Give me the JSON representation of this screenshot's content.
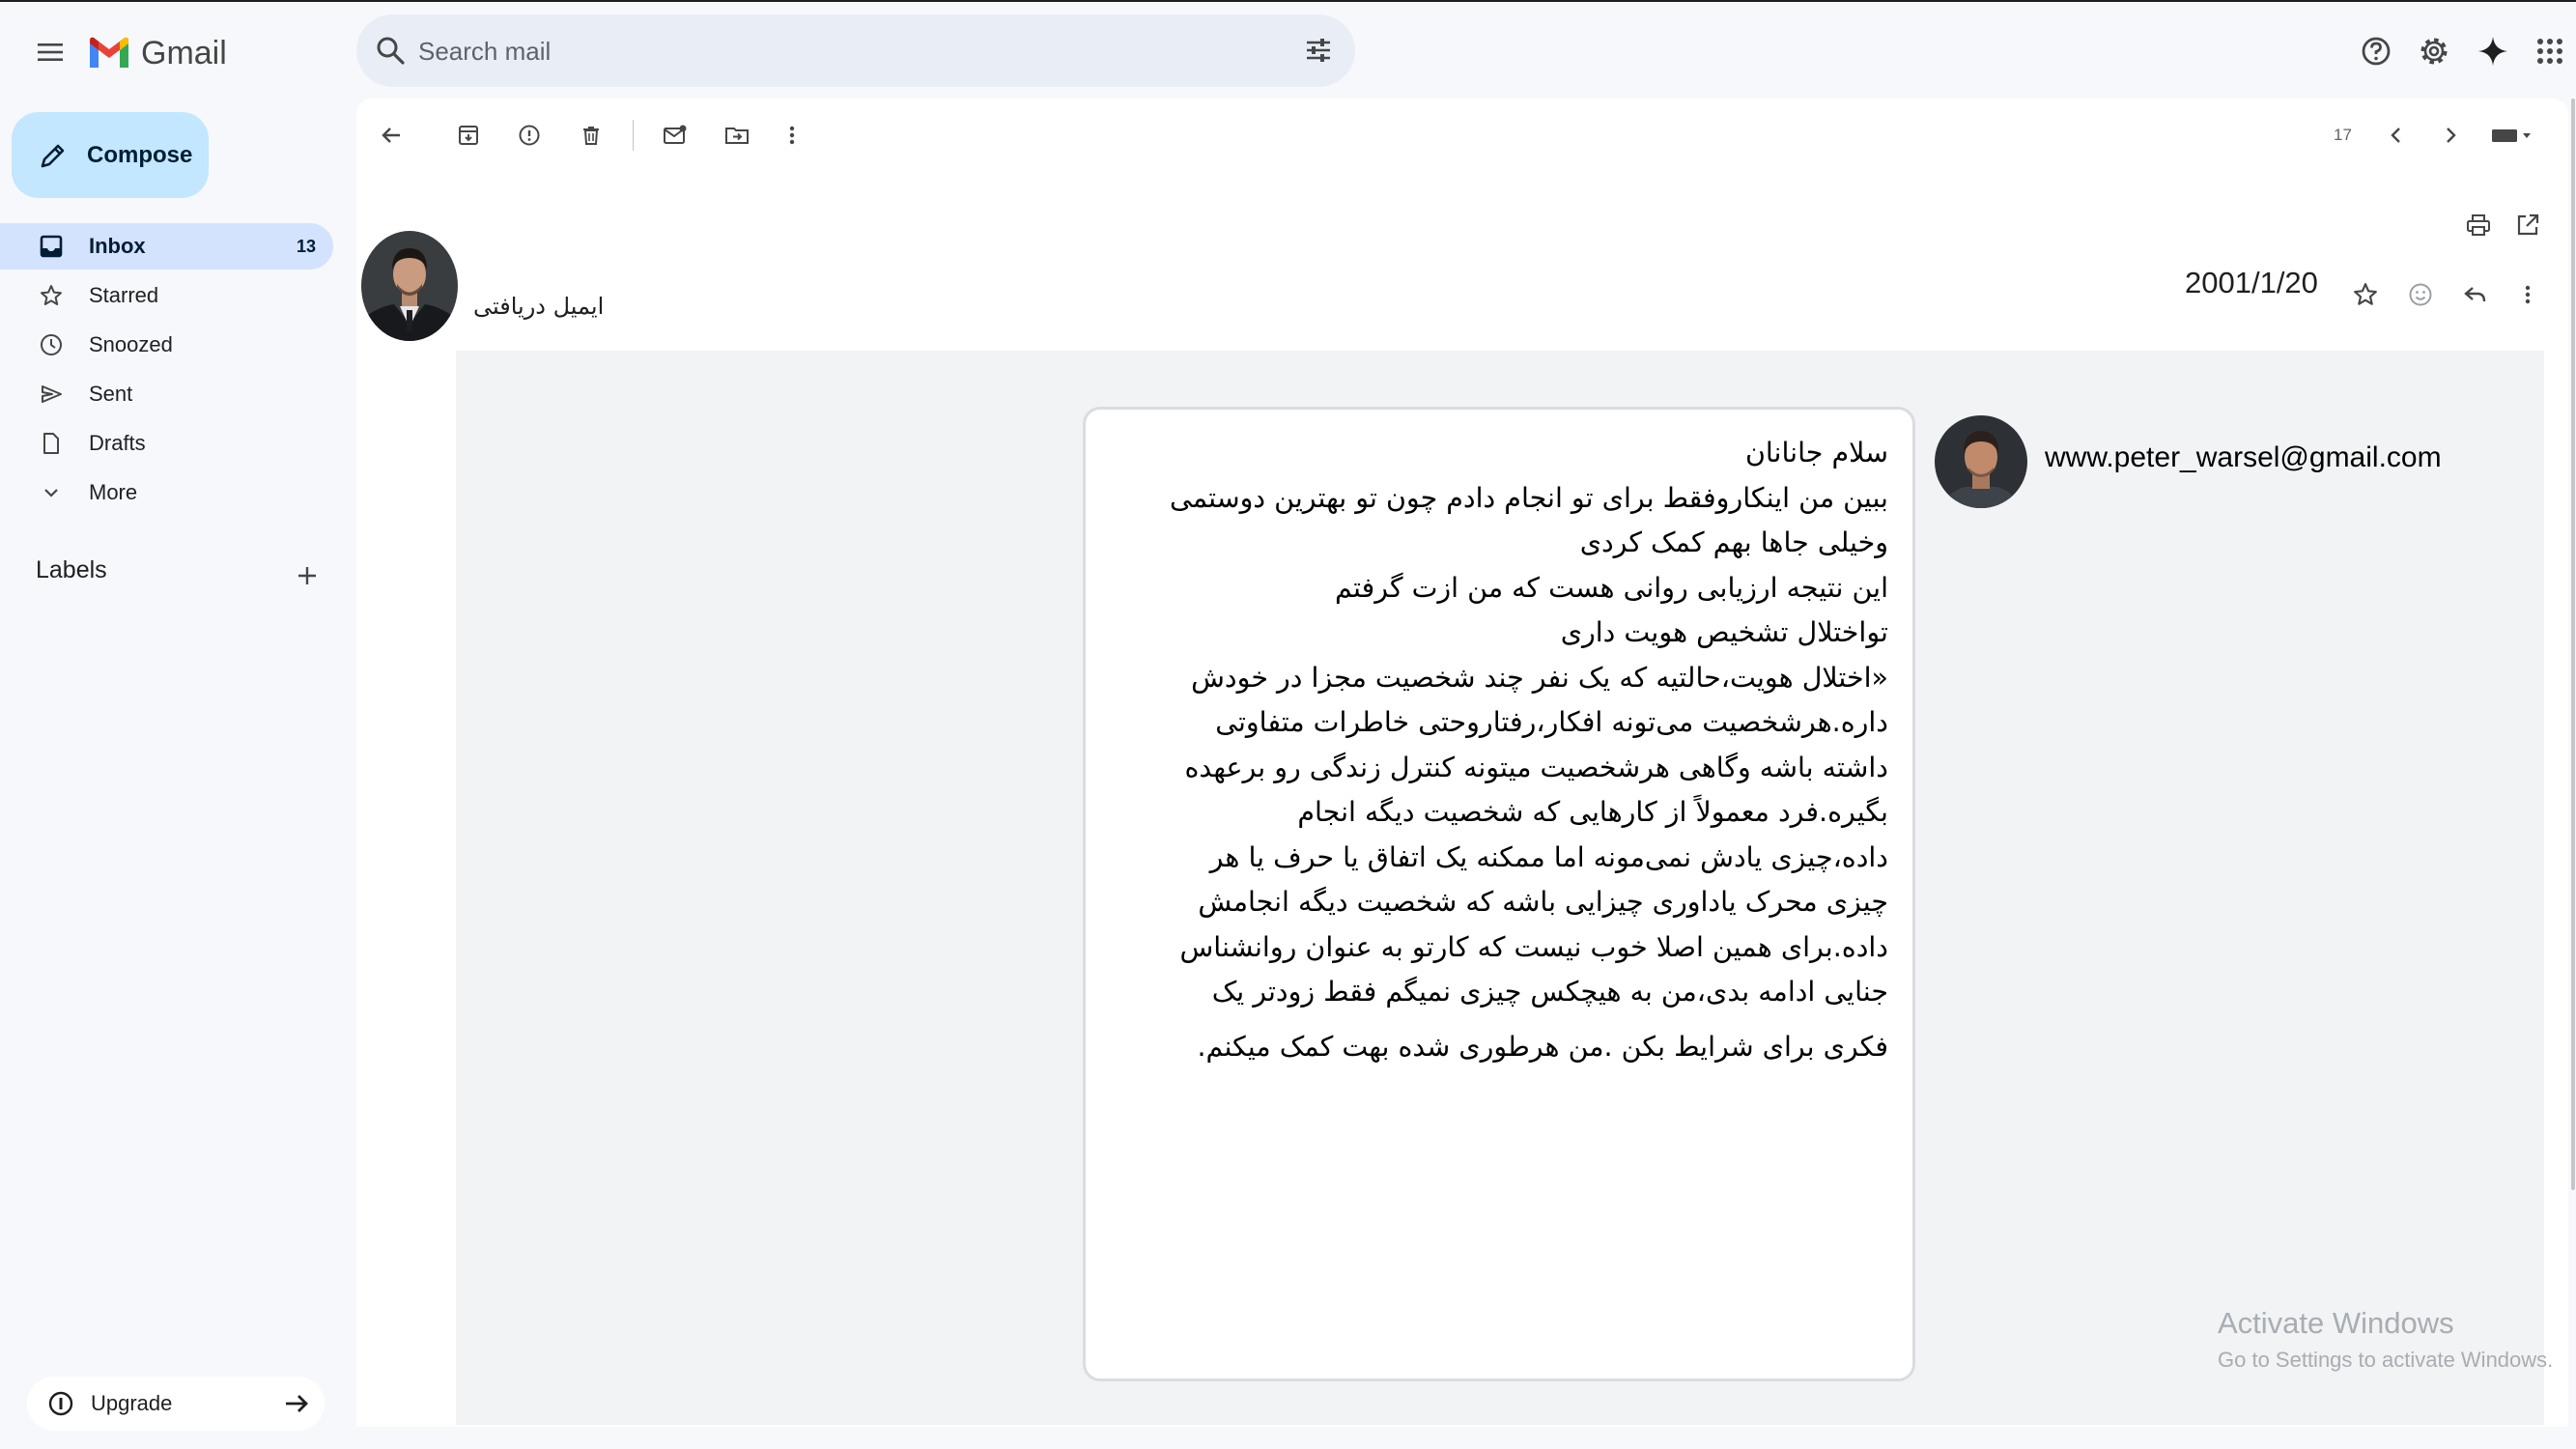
{
  "header": {
    "app_name": "Gmail",
    "search_placeholder": "Search mail",
    "icons": [
      "menu-icon",
      "help-icon",
      "settings-icon",
      "gemini-icon",
      "apps-icon"
    ]
  },
  "sidebar": {
    "compose_label": "Compose",
    "items": [
      {
        "label": "Inbox",
        "icon": "inbox-icon",
        "count": "13",
        "active": true
      },
      {
        "label": "Starred",
        "icon": "star-icon"
      },
      {
        "label": "Snoozed",
        "icon": "clock-icon"
      },
      {
        "label": "Sent",
        "icon": "send-icon"
      },
      {
        "label": "Drafts",
        "icon": "draft-icon"
      },
      {
        "label": "More",
        "icon": "chevron-down-icon"
      }
    ],
    "labels_title": "Labels",
    "upgrade_label": "Upgrade"
  },
  "toolbar": {
    "icons": [
      "back-icon",
      "archive-icon",
      "report-spam-icon",
      "delete-icon",
      "mark-unread-icon",
      "move-to-icon",
      "more-vert-icon"
    ],
    "pager_count": "17"
  },
  "message": {
    "sender_name": "ایمیل دریافتی",
    "date": "2001/1/20",
    "body_lines": [
      "سلام جانانان",
      "ببین من اینکاروفقط برای تو انجام دادم چون تو بهترین دوستمی",
      "وخیلی جاها بهم کمک کردی",
      "این نتیجه ارزیابی روانی هست که من ازت گرفتم",
      "تواختلال تشخیص هویت داری",
      "«اختلال هویت،حالتیه که یک نفر چند شخصیت مجزا در خودش",
      "داره.هرشخصیت می‌تونه افکار،رفتاروحتی خاطرات متفاوتی",
      "داشته باشه وگاهی هرشخصیت میتونه کنترل زندگی رو برعهده",
      "بگیره.فرد معمولاً از کارهایی که شخصیت دیگه انجام",
      "داده،چیزی یادش نمی‌مونه اما ممکنه یک اتفاق یا حرف یا هر",
      "چیزی محرک یاداوری چیزایی باشه که شخصیت دیگه انجامش",
      "داده.برای همین اصلا خوب نیست که کارتو به عنوان روانشناس",
      "جنایی ادامه بدی،من به هیچکس چیزی نمیگم فقط زودتر یک",
      "فکری برای شرایط بکن .من هرطوری شده بهت کمک میکنم."
    ],
    "email_address": "www.peter_warsel@gmail.com"
  },
  "watermark": {
    "line1": "Activate Windows",
    "line2": "Go to Settings to activate Windows."
  }
}
